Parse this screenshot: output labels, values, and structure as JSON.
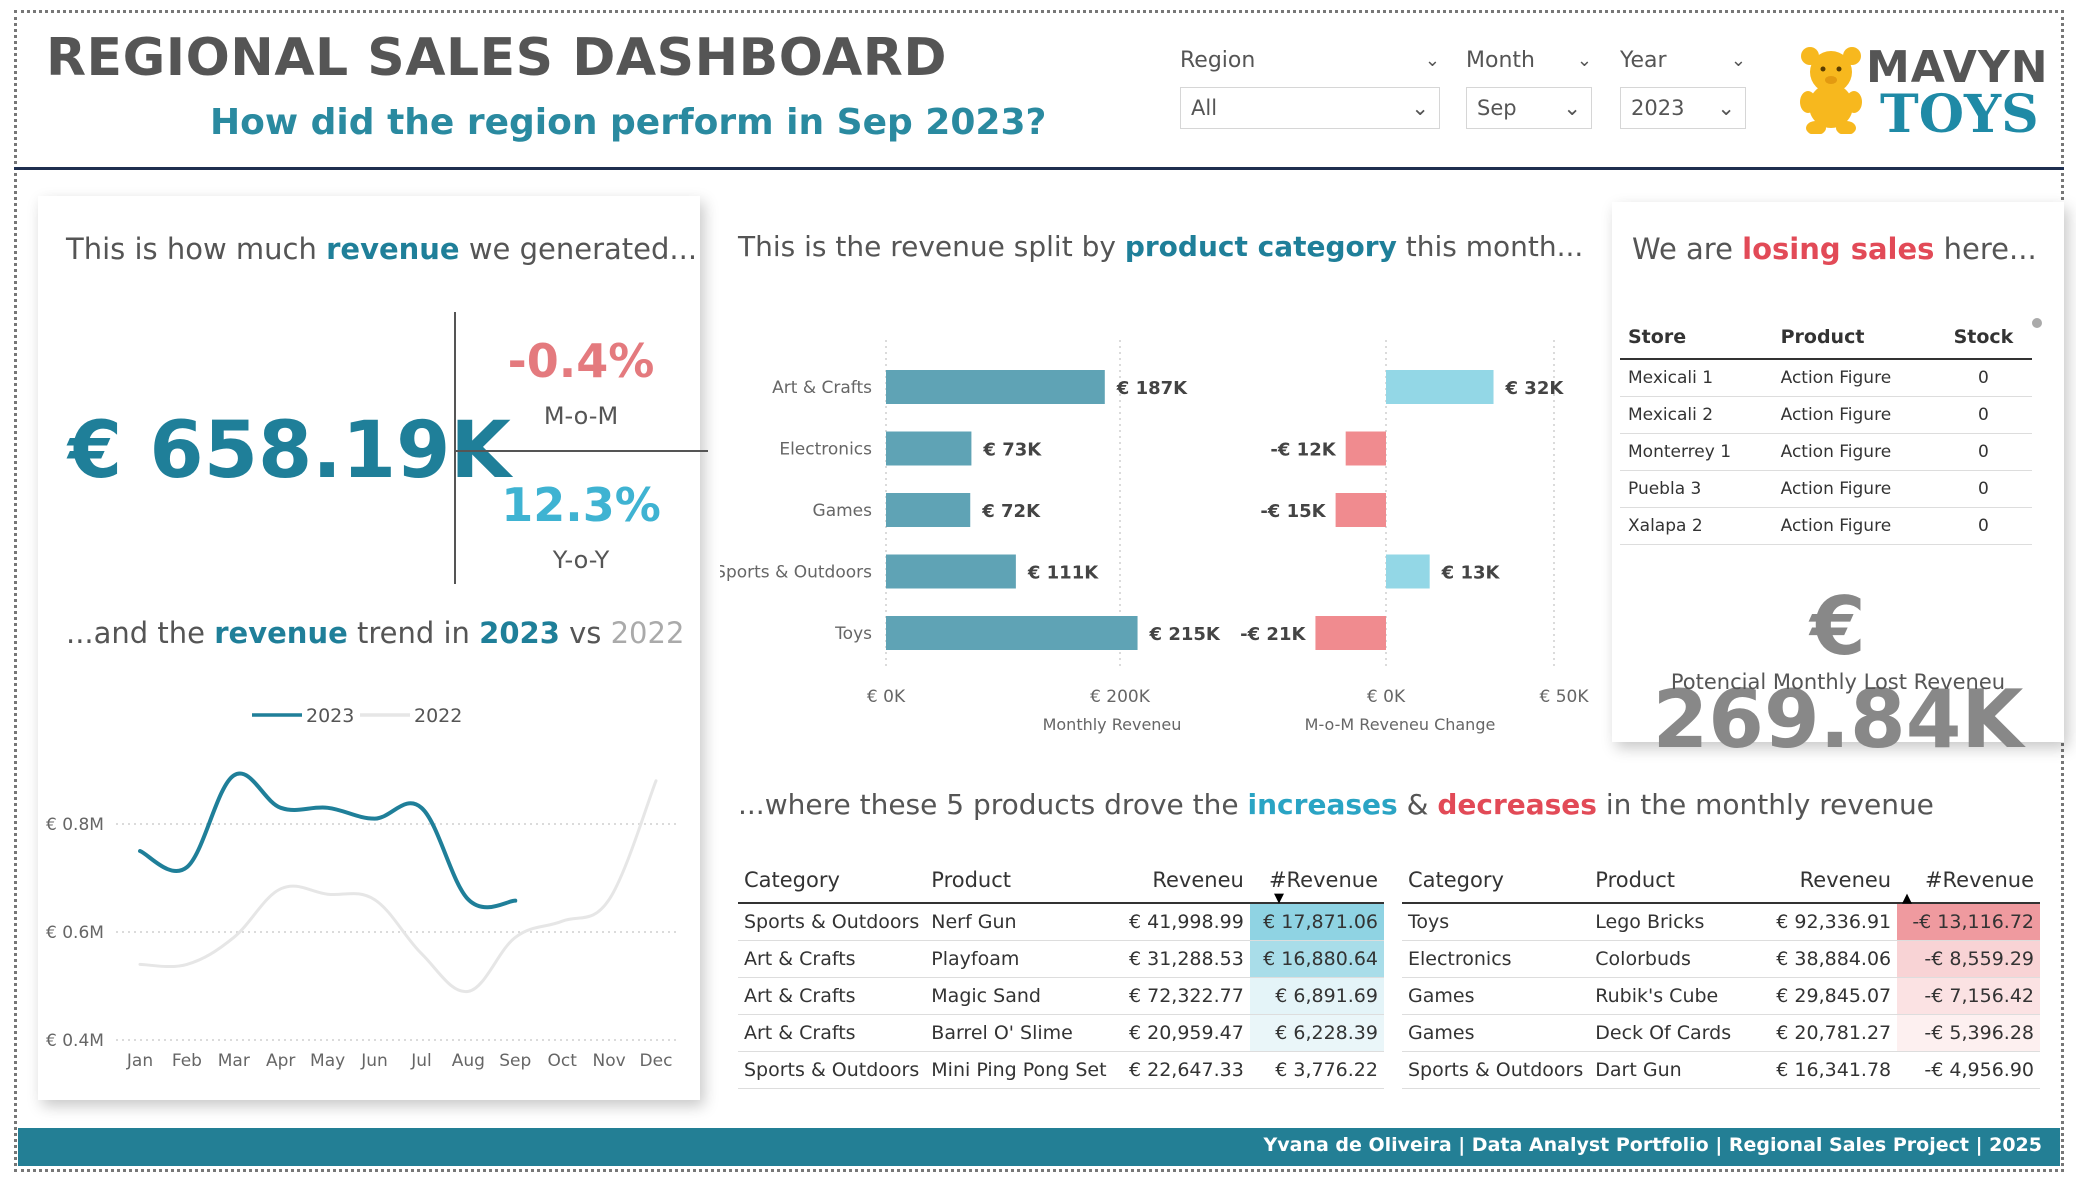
{
  "header": {
    "title": "REGIONAL SALES DASHBOARD",
    "subtitle": "How did the  region perform in Sep 2023?"
  },
  "filters": {
    "region": {
      "label": "Region",
      "value": "All"
    },
    "month": {
      "label": "Month",
      "value": "Sep"
    },
    "year": {
      "label": "Year",
      "value": "2023"
    }
  },
  "logo": {
    "line1": "MAVYN",
    "line2": "TOYS"
  },
  "revenue_card": {
    "title_pre": "This is how much ",
    "title_hl": "revenue",
    "title_post": " we generated...",
    "total": "€ 658.19K",
    "mom_value": "-0.4%",
    "mom_label": "M-o-M",
    "yoy_value": "12.3%",
    "yoy_label": "Y-o-Y",
    "trend_pre": "...and the ",
    "trend_hl": "revenue",
    "trend_mid": " trend in ",
    "trend_year1": "2023",
    "trend_vs": " vs ",
    "trend_year2": "2022"
  },
  "category_section": {
    "title_pre": "This is the revenue split by ",
    "title_hl": "product category",
    "title_post": " this month..."
  },
  "lost_card": {
    "title_pre": "We are ",
    "title_hl": "losing sales",
    "title_post": " here...",
    "columns": [
      "Store",
      "Product",
      "Stock"
    ],
    "rows": [
      [
        "Mexicali 1",
        "Action Figure",
        "0"
      ],
      [
        "Mexicali 2",
        "Action Figure",
        "0"
      ],
      [
        "Monterrey 1",
        "Action Figure",
        "0"
      ],
      [
        "Puebla 3",
        "Action Figure",
        "0"
      ],
      [
        "Xalapa 2",
        "Action Figure",
        "0"
      ]
    ],
    "total": "€ 269.84K",
    "total_label": "Potencial Monthly Lost Reveneu"
  },
  "products_section": {
    "title_pre": "...where these 5 products drove the ",
    "title_inc": "increases",
    "title_amp": " & ",
    "title_dec": "decreases",
    "title_post": " in the monthly revenue",
    "columns": [
      "Category",
      "Product",
      "Reveneu",
      "#Revenue"
    ],
    "increases": [
      [
        "Sports & Outdoors",
        "Nerf Gun",
        "€ 41,998.99",
        "€ 17,871.06"
      ],
      [
        "Art & Crafts",
        "Playfoam",
        "€ 31,288.53",
        "€ 16,880.64"
      ],
      [
        "Art & Crafts",
        "Magic Sand",
        "€ 72,322.77",
        "€ 6,891.69"
      ],
      [
        "Art & Crafts",
        "Barrel O' Slime",
        "€ 20,959.47",
        "€ 6,228.39"
      ],
      [
        "Sports & Outdoors",
        "Mini Ping Pong Set",
        "€ 22,647.33",
        "€ 3,776.22"
      ]
    ],
    "increase_colors": [
      "#8fd3e3",
      "#a9dde9",
      "#e4f4f8",
      "#eaf6f9",
      "#ffffff"
    ],
    "decreases": [
      [
        "Toys",
        "Lego Bricks",
        "€ 92,336.91",
        "-€ 13,116.72"
      ],
      [
        "Electronics",
        "Colorbuds",
        "€ 38,884.06",
        "-€ 8,559.29"
      ],
      [
        "Games",
        "Rubik's Cube",
        "€ 29,845.07",
        "-€ 7,156.42"
      ],
      [
        "Games",
        "Deck Of Cards",
        "€ 20,781.27",
        "-€ 5,396.28"
      ],
      [
        "Sports & Outdoors",
        "Dart Gun",
        "€ 16,341.78",
        "-€ 4,956.90"
      ]
    ],
    "decrease_colors": [
      "#ef9a9f",
      "#f8d3d5",
      "#fbe2e3",
      "#fdf0f0",
      "#ffffff"
    ]
  },
  "footer": {
    "text": "Yvana de Oliveira | Data Analyst Portfolio | Regional Sales Project | 2025"
  },
  "chart_data": [
    {
      "type": "line",
      "x": [
        "Jan",
        "Feb",
        "Mar",
        "Apr",
        "May",
        "Jun",
        "Jul",
        "Aug",
        "Sep",
        "Oct",
        "Nov",
        "Dec"
      ],
      "series": [
        {
          "name": "2023",
          "color": "#1f7f99",
          "values": [
            0.75,
            0.72,
            0.89,
            0.83,
            0.83,
            0.81,
            0.83,
            0.66,
            0.658,
            null,
            null,
            null
          ]
        },
        {
          "name": "2022",
          "color": "#e6e6e6",
          "values": [
            0.54,
            0.54,
            0.59,
            0.68,
            0.67,
            0.66,
            0.56,
            0.49,
            0.59,
            0.62,
            0.66,
            0.88
          ]
        }
      ],
      "yticks": [
        "€ 0.4M",
        "€ 0.6M",
        "€ 0.8M"
      ],
      "ylim": [
        0.4,
        0.9
      ]
    },
    {
      "type": "bar",
      "orientation": "horizontal",
      "categories": [
        "Art & Crafts",
        "Electronics",
        "Games",
        "Sports & Outdoors",
        "Toys"
      ],
      "values": [
        187,
        73,
        72,
        111,
        215
      ],
      "labels": [
        "€ 187K",
        "€ 73K",
        "€ 72K",
        "€ 111K",
        "€ 215K"
      ],
      "xlabel": "Monthly Reveneu",
      "xticks": [
        "€ 0K",
        "€ 200K"
      ],
      "xlim": [
        0,
        260
      ],
      "color": "#5fa3b5"
    },
    {
      "type": "bar",
      "orientation": "horizontal",
      "categories": [
        "Art & Crafts",
        "Electronics",
        "Games",
        "Sports & Outdoors",
        "Toys"
      ],
      "values": [
        32,
        -12,
        -15,
        13,
        -21
      ],
      "labels": [
        "€ 32K",
        "-€ 12K",
        "-€ 15K",
        "€ 13K",
        "-€ 21K"
      ],
      "xlabel": "M-o-M Reveneu Change",
      "xticks": [
        "€ 0K",
        "€ 50K"
      ],
      "xlim": [
        -30,
        50
      ],
      "pos_color": "#93d7e6",
      "neg_color": "#f08b8f"
    }
  ]
}
